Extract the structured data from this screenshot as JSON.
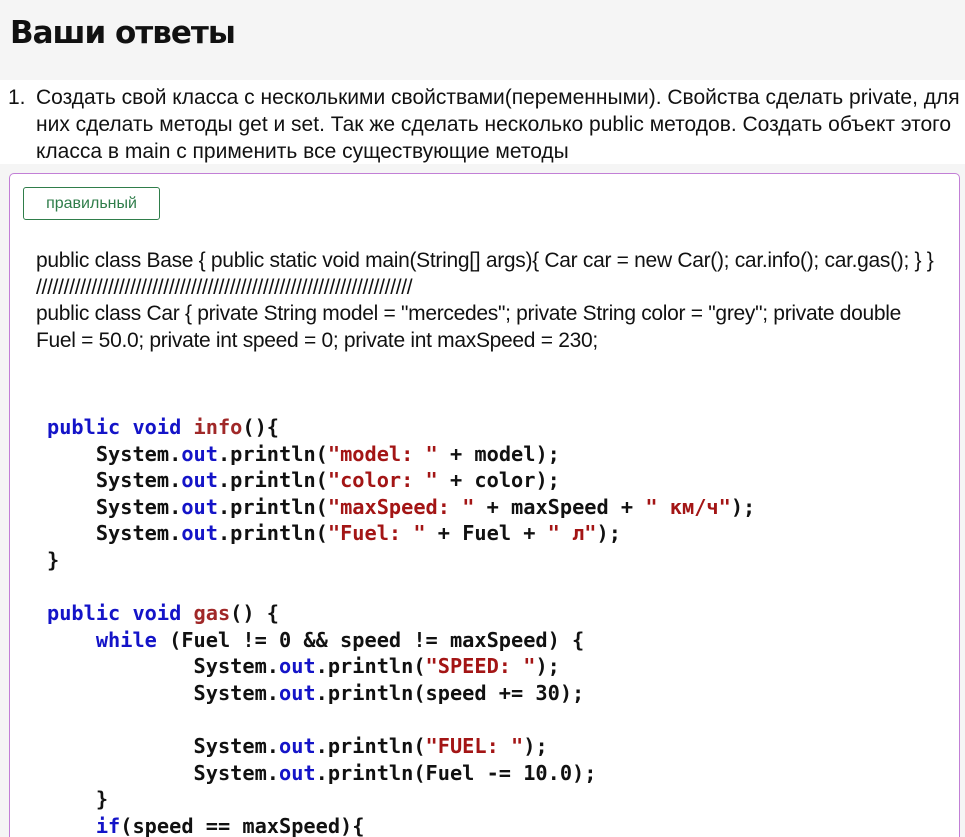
{
  "page": {
    "title": "Ваши ответы"
  },
  "question": {
    "number": "1.",
    "text": "Создать свой класса с несколькими свойствами(переменными). Свойства сделать private, для них сделать методы get и set. Так же сделать несколько public методов. Создать объект этого класса в main с применить все существующие методы"
  },
  "answer": {
    "verdict_label": "правильный",
    "text_lines": [
      "public class Base { public static void main(String[] args){ Car car = new Car(); car.info(); car.gas(); } }",
      "////////////////////////////////////////////////////////////////////",
      "public class Car { private String model = \"mercedes\"; private String color = \"grey\"; private double Fuel = 50.0; private int speed = 0; private int maxSpeed = 230;"
    ],
    "code_lines": [
      [
        {
          "t": "public void ",
          "c": "kw"
        },
        {
          "t": "info",
          "c": "fn"
        },
        {
          "t": "(){",
          "c": ""
        }
      ],
      [
        {
          "t": "    System.",
          "c": ""
        },
        {
          "t": "out",
          "c": "fld"
        },
        {
          "t": ".println(",
          "c": ""
        },
        {
          "t": "\"model: \"",
          "c": "str"
        },
        {
          "t": " + model);",
          "c": ""
        }
      ],
      [
        {
          "t": "    System.",
          "c": ""
        },
        {
          "t": "out",
          "c": "fld"
        },
        {
          "t": ".println(",
          "c": ""
        },
        {
          "t": "\"color: \"",
          "c": "str"
        },
        {
          "t": " + color);",
          "c": ""
        }
      ],
      [
        {
          "t": "    System.",
          "c": ""
        },
        {
          "t": "out",
          "c": "fld"
        },
        {
          "t": ".println(",
          "c": ""
        },
        {
          "t": "\"maxSpeed: \"",
          "c": "str"
        },
        {
          "t": " + maxSpeed + ",
          "c": ""
        },
        {
          "t": "\" км/ч\"",
          "c": "str"
        },
        {
          "t": ");",
          "c": ""
        }
      ],
      [
        {
          "t": "    System.",
          "c": ""
        },
        {
          "t": "out",
          "c": "fld"
        },
        {
          "t": ".println(",
          "c": ""
        },
        {
          "t": "\"Fuel: \"",
          "c": "str"
        },
        {
          "t": " + Fuel + ",
          "c": ""
        },
        {
          "t": "\" л\"",
          "c": "str"
        },
        {
          "t": ");",
          "c": ""
        }
      ],
      [
        {
          "t": "}",
          "c": ""
        }
      ],
      [
        {
          "t": "",
          "c": ""
        }
      ],
      [
        {
          "t": "public void ",
          "c": "kw"
        },
        {
          "t": "gas",
          "c": "fn"
        },
        {
          "t": "() {",
          "c": ""
        }
      ],
      [
        {
          "t": "    ",
          "c": ""
        },
        {
          "t": "while",
          "c": "kw"
        },
        {
          "t": " (Fuel != 0 && speed != maxSpeed) {",
          "c": ""
        }
      ],
      [
        {
          "t": "            System.",
          "c": ""
        },
        {
          "t": "out",
          "c": "fld"
        },
        {
          "t": ".println(",
          "c": ""
        },
        {
          "t": "\"SPEED: \"",
          "c": "str"
        },
        {
          "t": ");",
          "c": ""
        }
      ],
      [
        {
          "t": "            System.",
          "c": ""
        },
        {
          "t": "out",
          "c": "fld"
        },
        {
          "t": ".println(speed += 30);",
          "c": ""
        }
      ],
      [
        {
          "t": "",
          "c": ""
        }
      ],
      [
        {
          "t": "            System.",
          "c": ""
        },
        {
          "t": "out",
          "c": "fld"
        },
        {
          "t": ".println(",
          "c": ""
        },
        {
          "t": "\"FUEL: \"",
          "c": "str"
        },
        {
          "t": ");",
          "c": ""
        }
      ],
      [
        {
          "t": "            System.",
          "c": ""
        },
        {
          "t": "out",
          "c": "fld"
        },
        {
          "t": ".println(Fuel -= 10.0);",
          "c": ""
        }
      ],
      [
        {
          "t": "    }",
          "c": ""
        }
      ],
      [
        {
          "t": "    ",
          "c": ""
        },
        {
          "t": "if",
          "c": "kw"
        },
        {
          "t": "(speed == maxSpeed){",
          "c": ""
        }
      ]
    ]
  },
  "colors": {
    "keyword": "#1414c8",
    "method_name": "#a02828",
    "string": "#a31515",
    "verdict": "#2f7d4a",
    "answer_border": "#c27fd6"
  }
}
